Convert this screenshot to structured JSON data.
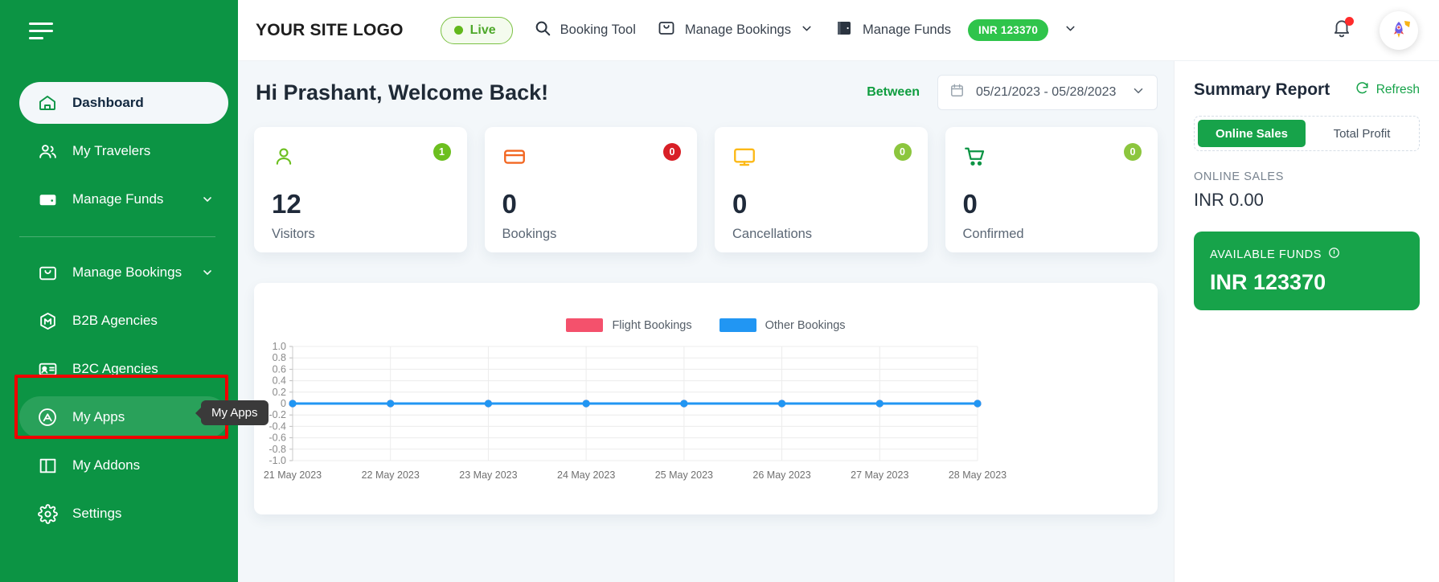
{
  "sidebar": {
    "menu_icon": "hamburger-icon",
    "items": [
      {
        "label": "Dashboard",
        "icon": "home-icon",
        "state": "active",
        "chevron": false
      },
      {
        "label": "My Travelers",
        "icon": "users-icon",
        "state": "normal",
        "chevron": false
      },
      {
        "label": "Manage Funds",
        "icon": "wallet-icon",
        "state": "normal",
        "chevron": true
      },
      {
        "label": "Manage Bookings",
        "icon": "bag-icon",
        "state": "normal",
        "chevron": true
      },
      {
        "label": "B2B Agencies",
        "icon": "hexagon-icon",
        "state": "normal",
        "chevron": false
      },
      {
        "label": "B2C Agencies",
        "icon": "id-card-icon",
        "state": "normal",
        "chevron": false
      },
      {
        "label": "My Apps",
        "icon": "appstore-icon",
        "state": "hover",
        "chevron": false
      },
      {
        "label": "My Addons",
        "icon": "columns-icon",
        "state": "normal",
        "chevron": false
      },
      {
        "label": "Settings",
        "icon": "gear-icon",
        "state": "normal",
        "chevron": false
      }
    ],
    "tooltip": "My Apps"
  },
  "topbar": {
    "logo": "YOUR SITE LOGO",
    "live_label": "Live",
    "booking_tool": "Booking Tool",
    "manage_bookings": "Manage Bookings",
    "manage_funds": "Manage Funds",
    "funds_badge": "INR 123370",
    "bell": "notification-bell-icon",
    "avatar": "rocket-avatar-icon"
  },
  "header": {
    "greeting": "Hi Prashant, Welcome Back!",
    "between_label": "Between",
    "date_range": "05/21/2023 - 05/28/2023"
  },
  "cards": [
    {
      "value": "12",
      "label": "Visitors",
      "badge": "1",
      "badge_color": "#6cbf1f",
      "icon": "person-icon",
      "icon_color": "#6cbf1f"
    },
    {
      "value": "0",
      "label": "Bookings",
      "badge": "0",
      "badge_color": "#d81f26",
      "icon": "card-icon",
      "icon_color": "#f26722"
    },
    {
      "value": "0",
      "label": "Cancellations",
      "badge": "0",
      "badge_color": "#8cc63e",
      "icon": "monitor-icon",
      "icon_color": "#fcb917"
    },
    {
      "value": "0",
      "label": "Confirmed",
      "badge": "0",
      "badge_color": "#8cc63e",
      "icon": "cart-icon",
      "icon_color": "#0c9444"
    }
  ],
  "summary": {
    "title": "Summary Report",
    "refresh": "Refresh",
    "tabs": [
      {
        "label": "Online Sales",
        "active": true
      },
      {
        "label": "Total Profit",
        "active": false
      }
    ],
    "sales_label": "ONLINE SALES",
    "sales_value": "INR 0.00",
    "funds_label": "AVAILABLE FUNDS",
    "funds_value": "INR 123370"
  },
  "chart_data": {
    "type": "line",
    "title": "",
    "xlabel": "",
    "ylabel": "",
    "categories": [
      "21 May 2023",
      "22 May 2023",
      "23 May 2023",
      "24 May 2023",
      "25 May 2023",
      "26 May 2023",
      "27 May 2023",
      "28 May 2023"
    ],
    "yticks": [
      "1.0",
      "0.8",
      "0.6",
      "0.4",
      "0.2",
      "0",
      "-0.2",
      "-0.4",
      "-0.6",
      "-0.8",
      "-1.0"
    ],
    "ylim": [
      -1.0,
      1.0
    ],
    "grid": true,
    "legend_position": "top-center",
    "series": [
      {
        "name": "Flight Bookings",
        "color": "#f4516c",
        "values": [
          0,
          0,
          0,
          0,
          0,
          0,
          0,
          0
        ]
      },
      {
        "name": "Other Bookings",
        "color": "#2196f3",
        "values": [
          0,
          0,
          0,
          0,
          0,
          0,
          0,
          0
        ]
      }
    ]
  },
  "colors": {
    "brand_green": "#0c9444",
    "accent_green": "#17a34a",
    "flight_pink": "#f4516c",
    "other_blue": "#2196f3",
    "highlight_red": "#ee0000"
  }
}
